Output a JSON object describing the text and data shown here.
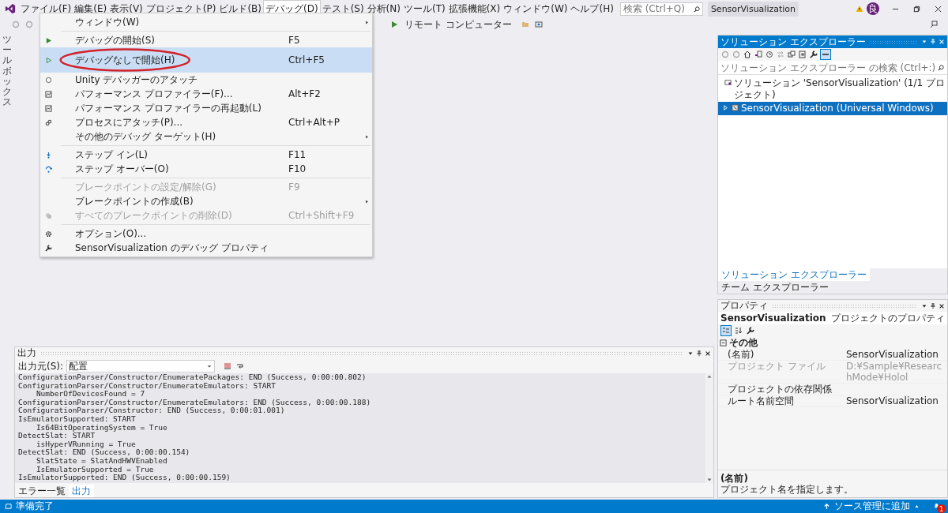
{
  "menubar": [
    {
      "label": "ファイル(F)",
      "selected": false
    },
    {
      "label": "編集(E)",
      "selected": false
    },
    {
      "label": "表示(V)",
      "selected": false
    },
    {
      "label": "プロジェクト(P)",
      "selected": false
    },
    {
      "label": "ビルド(B)",
      "selected": false
    },
    {
      "label": "デバッグ(D)",
      "selected": true
    },
    {
      "label": "テスト(S)",
      "selected": false
    },
    {
      "label": "分析(N)",
      "selected": false
    },
    {
      "label": "ツール(T)",
      "selected": false
    },
    {
      "label": "拡張機能(X)",
      "selected": false
    },
    {
      "label": "ウィンドウ(W)",
      "selected": false
    },
    {
      "label": "ヘルプ(H)",
      "selected": false
    }
  ],
  "search": {
    "placeholder": "検索 (Ctrl+Q)"
  },
  "solution_name": "SensorVisualization",
  "user_initial": "良",
  "toolbar": {
    "run_target": "リモート コンピューター"
  },
  "toolbox_tab": "ツールボックス",
  "debug_menu": [
    {
      "kind": "item",
      "label": "ウィンドウ(W)",
      "submenu": true,
      "disabled": false,
      "selected": false
    },
    {
      "kind": "separator"
    },
    {
      "kind": "item",
      "label": "デバッグの開始(S)",
      "shortcut": "F5",
      "submenu": false,
      "disabled": false,
      "selected": false
    },
    {
      "kind": "item",
      "label": "デバッグなしで開始(H)",
      "shortcut": "Ctrl+F5",
      "submenu": false,
      "disabled": false,
      "selected": true
    },
    {
      "kind": "item",
      "label": "Unity デバッガーのアタッチ",
      "submenu": false,
      "disabled": false,
      "selected": false
    },
    {
      "kind": "item",
      "label": "パフォーマンス プロファイラー(F)...",
      "shortcut": "Alt+F2",
      "submenu": false,
      "disabled": false,
      "selected": false
    },
    {
      "kind": "item",
      "label": "パフォーマンス プロファイラーの再起動(L)",
      "submenu": false,
      "disabled": false,
      "selected": false
    },
    {
      "kind": "item",
      "label": "プロセスにアタッチ(P)...",
      "shortcut": "Ctrl+Alt+P",
      "submenu": false,
      "disabled": false,
      "selected": false
    },
    {
      "kind": "item",
      "label": "その他のデバッグ ターゲット(H)",
      "submenu": true,
      "disabled": false,
      "selected": false
    },
    {
      "kind": "separator"
    },
    {
      "kind": "item",
      "label": "ステップ イン(L)",
      "shortcut": "F11",
      "submenu": false,
      "disabled": false,
      "selected": false
    },
    {
      "kind": "item",
      "label": "ステップ オーバー(O)",
      "shortcut": "F10",
      "submenu": false,
      "disabled": false,
      "selected": false
    },
    {
      "kind": "separator"
    },
    {
      "kind": "item",
      "label": "ブレークポイントの設定/解除(G)",
      "shortcut": "F9",
      "submenu": false,
      "disabled": true,
      "selected": false
    },
    {
      "kind": "item",
      "label": "ブレークポイントの作成(B)",
      "submenu": true,
      "disabled": false,
      "selected": false
    },
    {
      "kind": "item",
      "label": "すべてのブレークポイントの削除(D)",
      "shortcut": "Ctrl+Shift+F9",
      "submenu": false,
      "disabled": true,
      "selected": false
    },
    {
      "kind": "separator"
    },
    {
      "kind": "item",
      "label": "オプション(O)...",
      "submenu": false,
      "disabled": false,
      "selected": false
    },
    {
      "kind": "item",
      "label": "SensorVisualization のデバッグ プロパティ",
      "submenu": false,
      "disabled": false,
      "selected": false
    }
  ],
  "solution_explorer": {
    "title": "ソリューション エクスプローラー",
    "search": {
      "placeholder": "ソリューション エクスプローラー の検索 (Ctrl+:)"
    },
    "tree": [
      {
        "label": "ソリューション 'SensorVisualization' (1/1 プロジェクト)",
        "selected": false,
        "children": [
          {
            "label": "SensorVisualization (Universal Windows)",
            "selected": true,
            "expanded": false
          }
        ]
      }
    ]
  },
  "explorer_tabs": [
    {
      "label": "ソリューション エクスプローラー",
      "selected": true
    },
    {
      "label": "チーム エクスプローラー",
      "selected": false
    }
  ],
  "properties": {
    "title": "プロパティ",
    "object": "SensorVisualization",
    "object_type": "プロジェクトのプロパティ",
    "category": "その他",
    "rows": [
      {
        "name": "(名前)",
        "value": "SensorVisualization",
        "disabled": false
      },
      {
        "name": "プロジェクト ファイル",
        "value": "D:¥Sample¥ResearchMode¥Holol",
        "disabled": true
      },
      {
        "name": "プロジェクトの依存関係",
        "disabled": false
      },
      {
        "name": "ルート名前空間",
        "value": "SensorVisualization",
        "disabled": false
      }
    ],
    "description_title": "(名前)",
    "description": "プロジェクト名を指定します。"
  },
  "output": {
    "title": "出力",
    "source_label": "出力元(S):",
    "source": "配置",
    "lines": [
      "ConfigurationParser/Constructor/EnumeratePackages: END (Success, 0:00:00.802)",
      "ConfigurationParser/Constructor/EnumerateEmulators: START",
      "    NumberOfDevicesFound = 7",
      "ConfigurationParser/Constructor/EnumerateEmulators: END (Success, 0:00:00.188)",
      "ConfigurationParser/Constructor: END (Success, 0:00:01.001)",
      "IsEmulatorSupported: START",
      "    Is64BitOperatingSystem = True",
      "DetectSlat: START",
      "    isHyperVRunning = True",
      "DetectSlat: END (Success, 0:00:00.154)",
      "    SlatState = SlatAndHWVEnabled",
      "    IsEmulatorSupported = True",
      "IsEmulatorSupported: END (Success, 0:00:00.159)"
    ]
  },
  "output_tabs": [
    {
      "label": "エラー一覧",
      "selected": false
    },
    {
      "label": "出力",
      "selected": true
    }
  ],
  "status_bar": {
    "text": "準備完了",
    "source_control": "ソース管理に追加",
    "notifications": "1"
  }
}
